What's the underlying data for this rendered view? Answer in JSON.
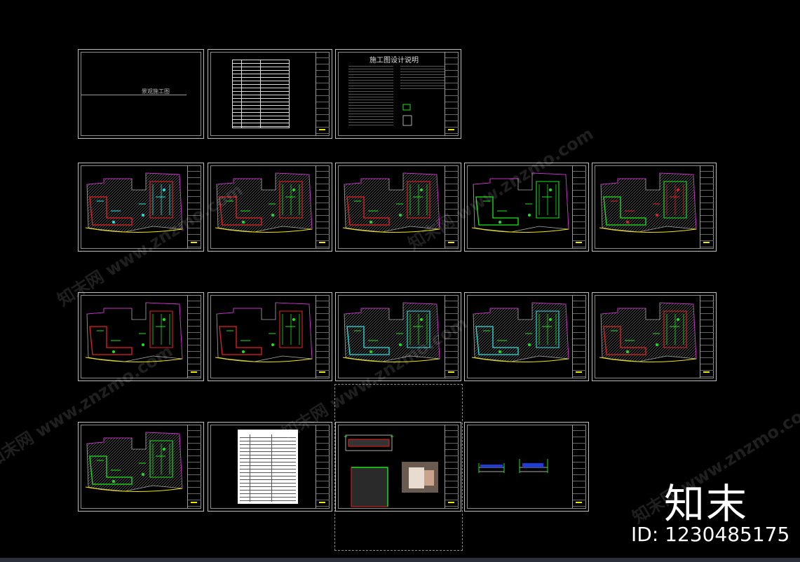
{
  "canvas": {
    "background": "#000000"
  },
  "sheets": [
    {
      "id": "r1c1",
      "kind": "cover",
      "text": "景观施工图"
    },
    {
      "id": "r1c2",
      "kind": "index"
    },
    {
      "id": "r1c3",
      "kind": "notes",
      "text": "施工图设计说明"
    },
    {
      "id": "r2c1",
      "kind": "plan"
    },
    {
      "id": "r2c2",
      "kind": "plan"
    },
    {
      "id": "r2c3",
      "kind": "plan"
    },
    {
      "id": "r2c4",
      "kind": "plan"
    },
    {
      "id": "r2c5",
      "kind": "plan"
    },
    {
      "id": "r3c1",
      "kind": "plan"
    },
    {
      "id": "r3c2",
      "kind": "plan"
    },
    {
      "id": "r3c3",
      "kind": "plan"
    },
    {
      "id": "r3c4",
      "kind": "plan"
    },
    {
      "id": "r3c5",
      "kind": "plan"
    },
    {
      "id": "r4c1",
      "kind": "plan"
    },
    {
      "id": "r4c2",
      "kind": "table"
    },
    {
      "id": "r4c3",
      "kind": "detail"
    },
    {
      "id": "r4c4",
      "kind": "section"
    }
  ],
  "colors": {
    "green": "#19e619",
    "red": "#e62020",
    "cyan": "#1ee6e6",
    "yellow": "#f2e600",
    "magenta": "#d81bd8",
    "line": "#bdbdbd"
  },
  "watermark": {
    "text": "知末网 www.znzmo.com"
  },
  "brand": {
    "logo": "知末",
    "id_text": "ID: 1230485175"
  }
}
